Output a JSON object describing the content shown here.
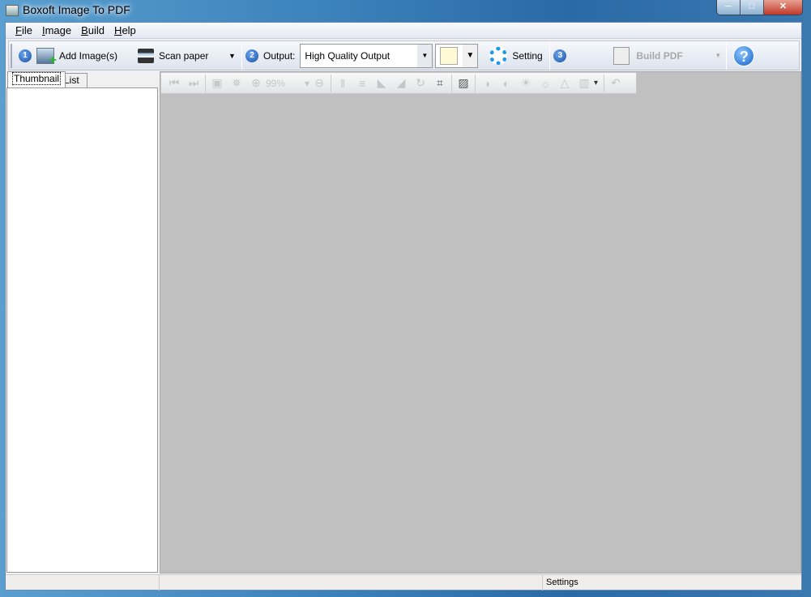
{
  "window": {
    "title": "Boxoft Image To PDF",
    "controls": [
      "minimize",
      "maximize",
      "close"
    ]
  },
  "menu": [
    {
      "label": "File",
      "key": "F",
      "rest": "ile"
    },
    {
      "label": "Image",
      "key": "I",
      "rest": "mage"
    },
    {
      "label": "Build",
      "key": "B",
      "rest": "uild"
    },
    {
      "label": "Help",
      "key": "H",
      "rest": "elp"
    }
  ],
  "toolbar": {
    "step1": "1",
    "add_images": "Add Image(s)",
    "scan_paper": "Scan paper",
    "step2": "2",
    "output_label": "Output:",
    "output_value": "High Quality Output",
    "color_swatch": "#fff9d6",
    "setting": "Setting",
    "step3": "3",
    "build_pdf": "Build PDF",
    "help": "?"
  },
  "tabs": {
    "thumbnail": "Thumbnail",
    "list": "List"
  },
  "viewer_toolbar": {
    "zoom": "99%",
    "icons": [
      "first-page",
      "last-page",
      "|",
      "fit-page",
      "actual-size",
      "zoom-in",
      "zoom-value",
      "zoom-out",
      "|",
      "flip-horizontal",
      "flip-vertical",
      "rotate-left",
      "rotate-right",
      "rotate",
      "crop",
      "|",
      "image-settings",
      "|",
      "contrast-up",
      "contrast-down",
      "brightness-up",
      "brightness-down",
      "sharpen",
      "layout",
      "|",
      "restore"
    ]
  },
  "status": {
    "panel1": "",
    "panel2": "",
    "panel3": "Settings"
  },
  "colors": {
    "viewer_bg": "#c0c0c0",
    "accent": "#1a4fa8"
  }
}
